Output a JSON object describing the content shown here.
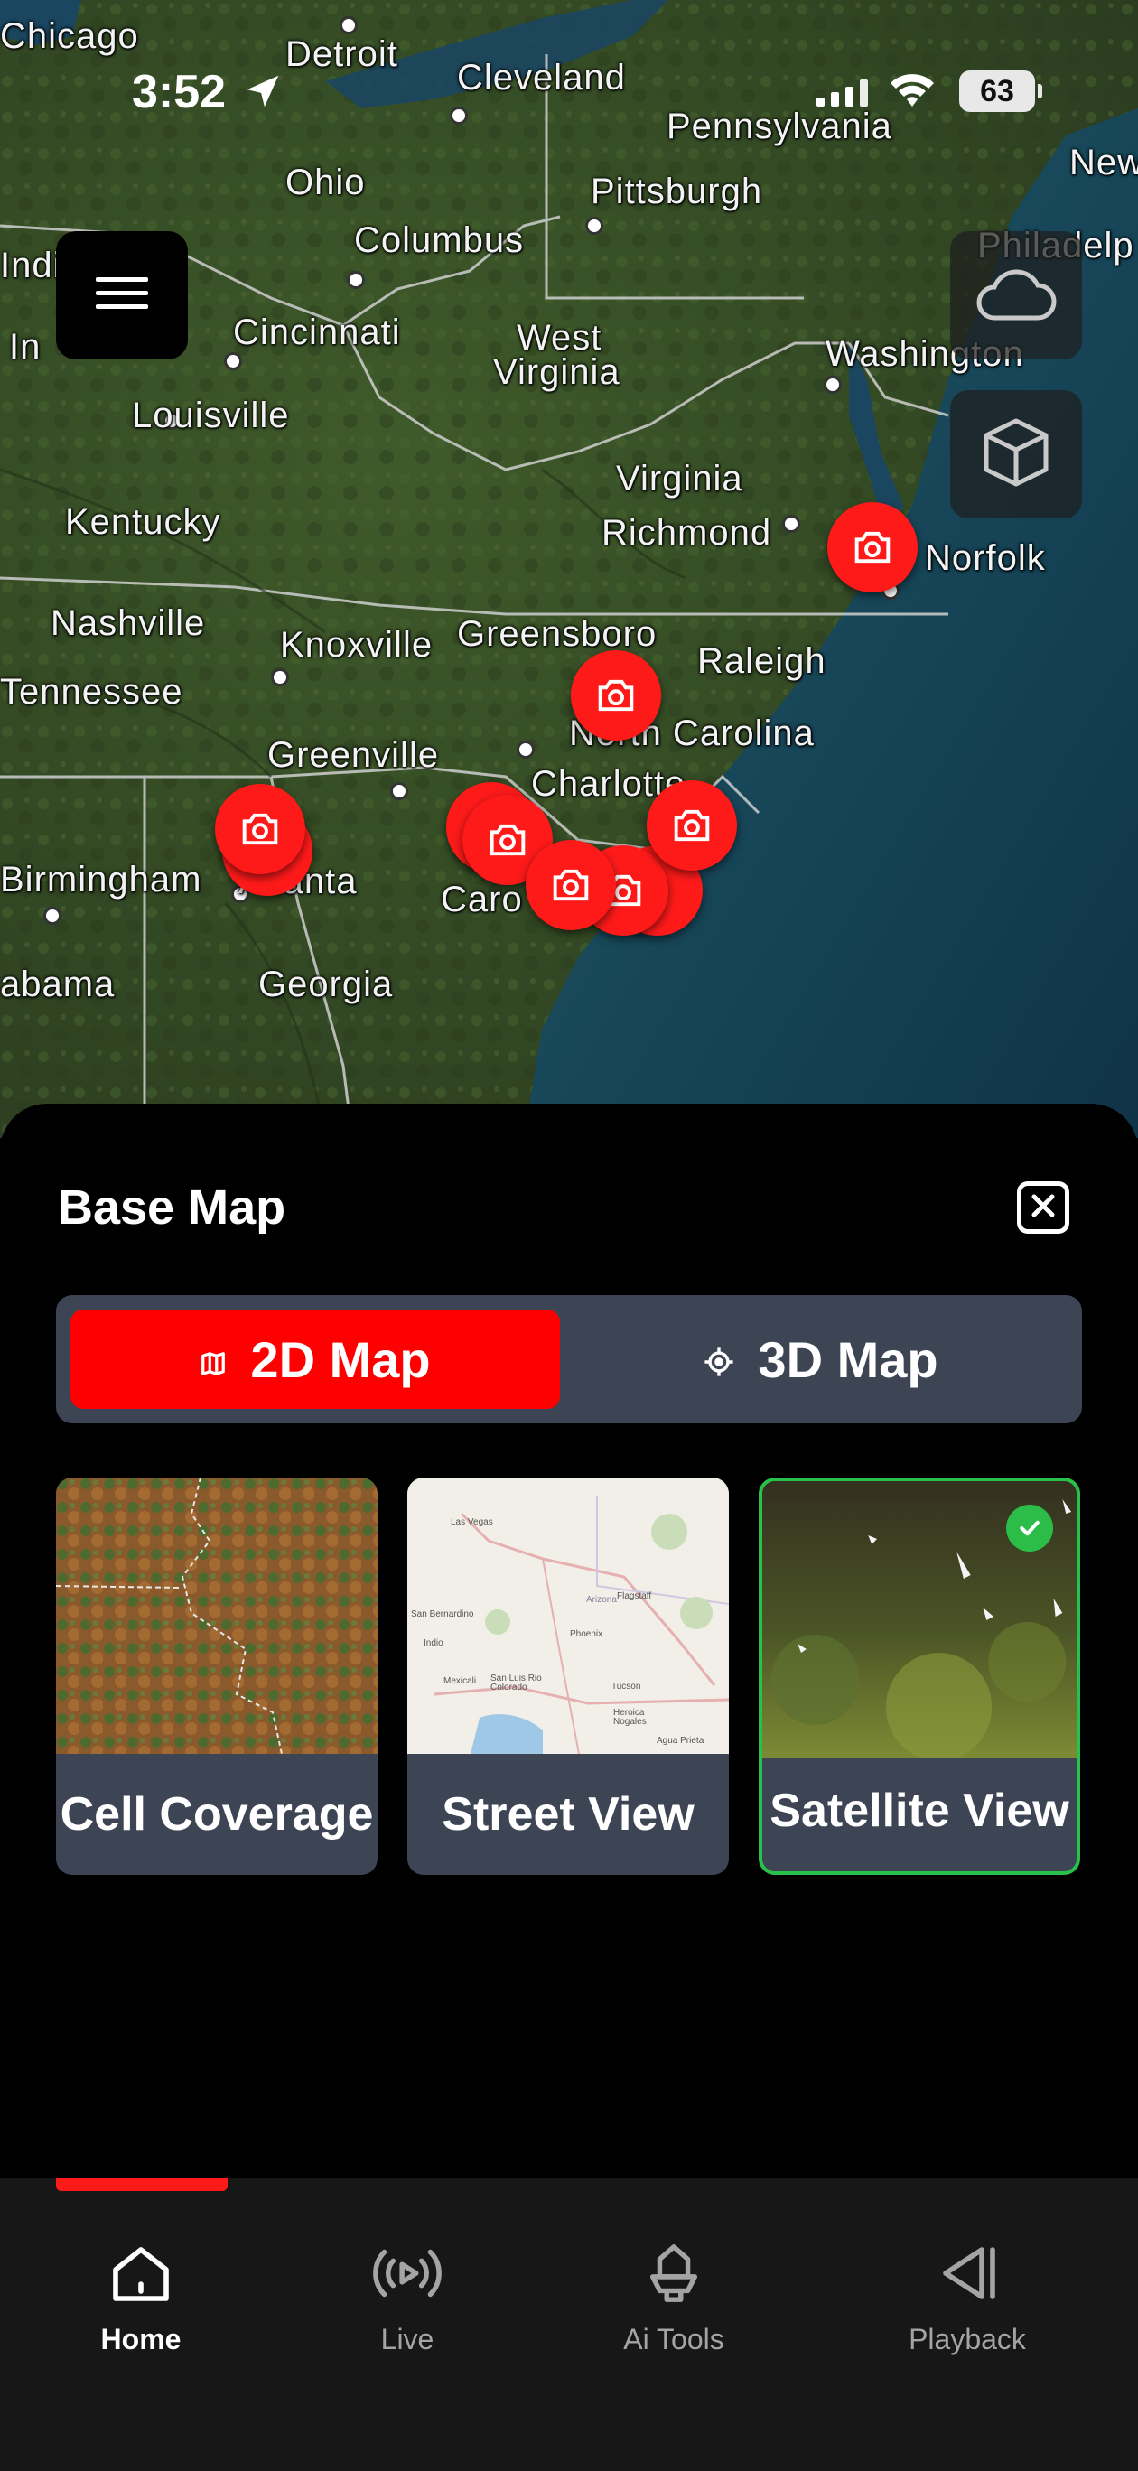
{
  "status_bar": {
    "time": "3:52",
    "battery": "63",
    "icons": [
      "location-arrow-icon",
      "signal-icon",
      "wifi-icon",
      "battery-icon"
    ]
  },
  "map": {
    "labels": [
      "Chicago",
      "Detroit",
      "Cleveland",
      "Pennsylvania",
      "New",
      "Ohio",
      "Pittsburgh",
      "Columbus",
      "Indi",
      "Philadelp",
      "In",
      "Cincinnati",
      "West",
      "Virginia",
      "Washington",
      "Louisville",
      "Virginia",
      "Kentucky",
      "Richmond",
      "Norfolk",
      "Nashville",
      "Knoxville",
      "Greensboro",
      "Raleigh",
      "Tennessee",
      "North Carolina",
      "Greenville",
      "Charlotte",
      "Birmingham",
      "Atlanta",
      "Caro",
      "abama",
      "Georgia"
    ],
    "marker_icon": "camera-icon",
    "marker_count": 9
  },
  "floating_buttons": {
    "menu_icon": "hamburger-menu-icon",
    "weather_icon": "cloud-icon",
    "view_3d_icon": "cube-icon"
  },
  "sheet": {
    "title": "Base Map",
    "close_icon": "close-icon",
    "toggle": {
      "options": [
        {
          "label": "2D Map",
          "icon": "map-icon",
          "selected": true
        },
        {
          "label": "3D Map",
          "icon": "crosshair-icon",
          "selected": false
        }
      ]
    },
    "map_styles": [
      {
        "label": "Cell Coverage",
        "selected": false
      },
      {
        "label": "Street View",
        "selected": false,
        "thumb_labels": [
          "Las Vegas",
          "Flagstaff",
          "San Bernardino",
          "Phoenix",
          "Mexicali",
          "San Luis Rio Colorado",
          "Tucson",
          "Heroica Nogales",
          "Agua Prieta",
          "Indio",
          "Arizona"
        ]
      },
      {
        "label": "Satellite View",
        "selected": true
      }
    ],
    "accent_color": "#ff0000",
    "selected_border_color": "#28c24a"
  },
  "tabbar": {
    "tabs": [
      {
        "label": "Home",
        "icon": "home-icon",
        "active": true
      },
      {
        "label": "Live",
        "icon": "live-broadcast-icon",
        "active": false
      },
      {
        "label": "Ai Tools",
        "icon": "ai-tools-icon",
        "active": false
      },
      {
        "label": "Playback",
        "icon": "playback-icon",
        "active": false
      }
    ]
  }
}
